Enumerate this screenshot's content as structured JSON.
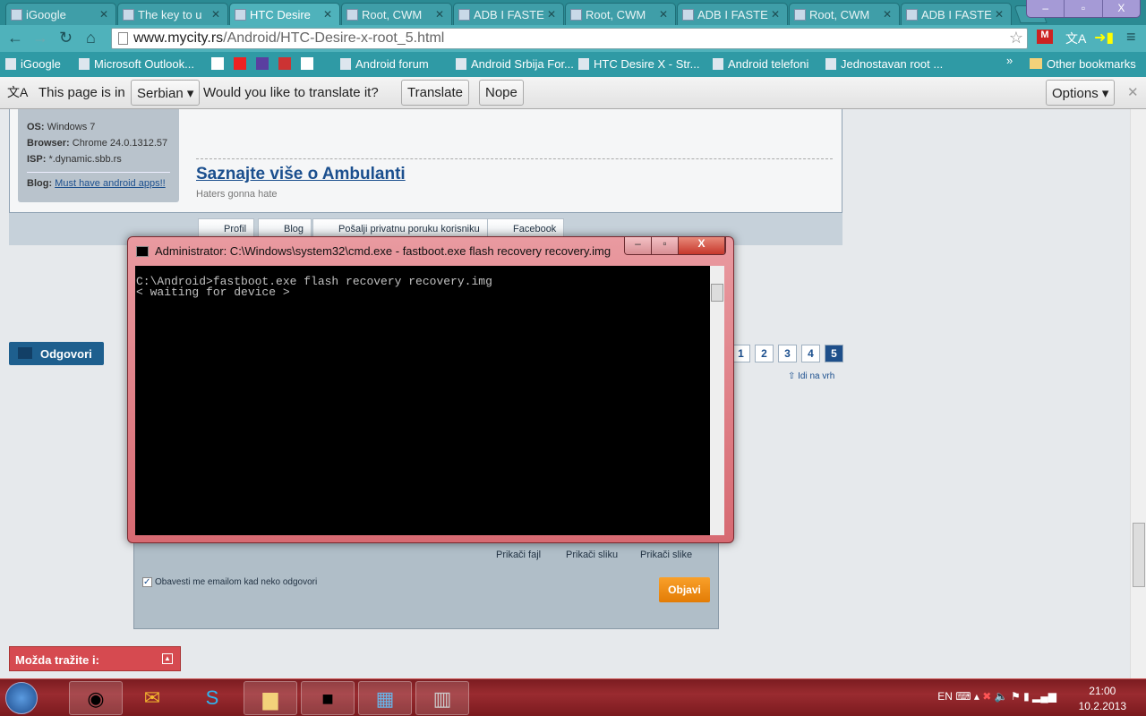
{
  "tabs": [
    {
      "label": "iGoogle"
    },
    {
      "label": "The key to u"
    },
    {
      "label": "HTC Desire"
    },
    {
      "label": "Root, CWM"
    },
    {
      "label": "ADB I FASTE"
    },
    {
      "label": "Root, CWM"
    },
    {
      "label": "ADB I FASTE"
    },
    {
      "label": "Root, CWM"
    },
    {
      "label": "ADB I FASTE"
    }
  ],
  "active_tab": 2,
  "window_controls": {
    "min": "–",
    "max": "▫",
    "close": "X"
  },
  "url": {
    "host": "www.mycity.rs",
    "path": "/Android/HTC-Desire-x-root_5.html"
  },
  "bookmarks": [
    {
      "label": "iGoogle"
    },
    {
      "label": "Microsoft Outlook..."
    },
    {
      "label": "Android forum"
    },
    {
      "label": "Android Srbija For..."
    },
    {
      "label": "HTC Desire X - Str..."
    },
    {
      "label": "Android telefoni"
    },
    {
      "label": "Jednostavan root ..."
    }
  ],
  "bookmarks_more": "»",
  "other_bookmarks": "Other bookmarks",
  "translate": {
    "prefix": "This page is in",
    "language": "Serbian",
    "question": "Would you like to translate it?",
    "translate": "Translate",
    "nope": "Nope",
    "options": "Options"
  },
  "userinfo": {
    "os_label": "OS:",
    "os": "Windows 7",
    "browser_label": "Browser:",
    "browser": "Chrome 24.0.1312.57",
    "isp_label": "ISP:",
    "isp": "*.dynamic.sbb.rs",
    "blog_label": "Blog:",
    "blog": "Must have android apps!!"
  },
  "signature": {
    "title": "Saznajte više o Ambulanti",
    "sub": "Haters gonna hate"
  },
  "post_buttons": [
    "Profil",
    "Blog",
    "Pošalji privatnu poruku korisniku",
    "Facebook"
  ],
  "reply_button": "Odgovori",
  "pagination": [
    "1",
    "2",
    "3",
    "4",
    "5"
  ],
  "current_page": "5",
  "to_top": "⇧ Idi na vrh",
  "reply_form": {
    "attach_file": "Prikači fajl",
    "attach_image": "Prikači sliku",
    "attach_images": "Prikači slike",
    "notify": "Obavesti me emailom kad neko odgovori",
    "notify_checked": true,
    "submit": "Objavi"
  },
  "maybe": "Možda tražite i:",
  "cmd": {
    "title": "Administrator: C:\\Windows\\system32\\cmd.exe - fastboot.exe  flash recovery recovery.img",
    "output": "C:\\Android>fastboot.exe flash recovery recovery.img\n< waiting for device >"
  },
  "tray": {
    "lang": "EN",
    "time": "21:00",
    "date": "10.2.2013"
  }
}
